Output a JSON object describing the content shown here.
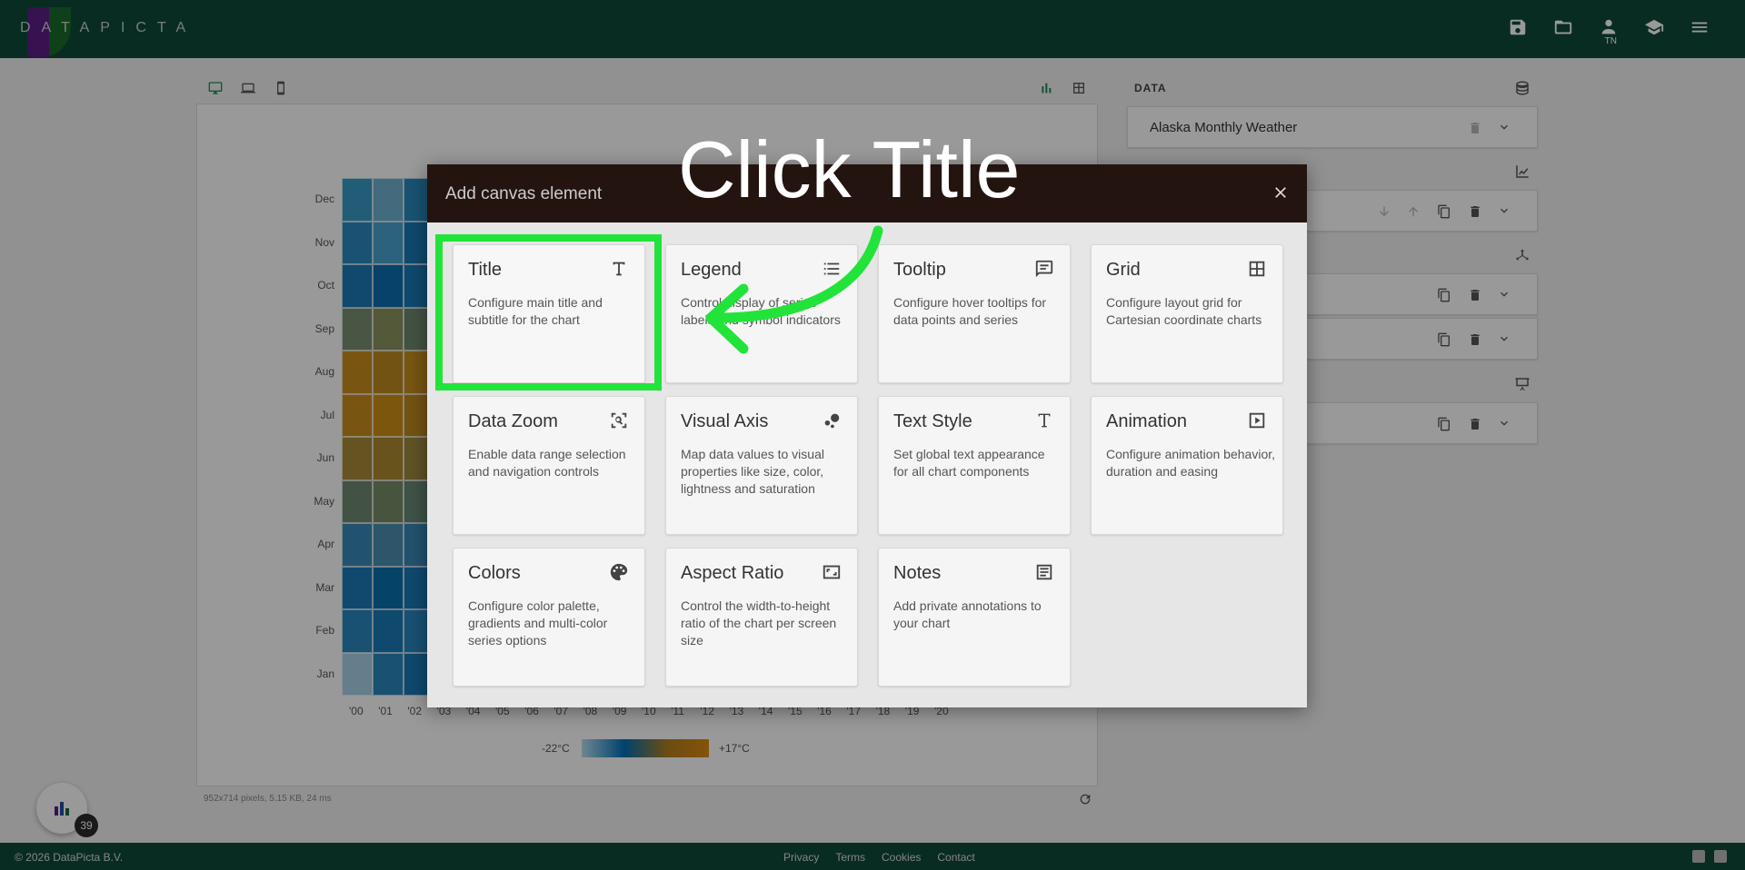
{
  "app": {
    "logo_text": "DATAPICTA",
    "user_initials": "TN",
    "logo_colors": [
      "#5a1f86",
      "#1c6b2a",
      "#1f4fa3"
    ]
  },
  "topbar_icons": [
    "save-icon",
    "folder-open-icon",
    "user-icon",
    "graduation-cap-icon",
    "menu-icon"
  ],
  "canvas": {
    "status": "952x714 pixels, 5.15 KB, 24 ms",
    "heatmap": {
      "months": [
        "Dec",
        "Nov",
        "Oct",
        "Sep",
        "Aug",
        "Jul",
        "Jun",
        "May",
        "Apr",
        "Mar",
        "Feb",
        "Jan"
      ],
      "years": [
        "'00",
        "'01",
        "'02",
        "'03",
        "'04",
        "'05",
        "'06",
        "'07",
        "'08",
        "'09",
        "'10",
        "'11",
        "'12",
        "'13",
        "'14",
        "'15",
        "'16",
        "'17",
        "'18",
        "'19",
        "'20"
      ],
      "legend_min": "-22°C",
      "legend_max": "+17°C",
      "visible_colors": [
        [
          "#3a9bc8",
          "#6fb3d0",
          "#2a8ac0"
        ],
        [
          "#2a8ac0",
          "#4aa4cd",
          "#1a7ab8"
        ],
        [
          "#1a7ab8",
          "#0a6fb0",
          "#1a7ab8"
        ],
        [
          "#7a9070",
          "#8a9460",
          "#708a70"
        ],
        [
          "#c8901e",
          "#c08a20",
          "#c8901e"
        ],
        [
          "#c8901e",
          "#d09018",
          "#c08a20"
        ],
        [
          "#a88a3a",
          "#b08a30",
          "#a08a40"
        ],
        [
          "#708a70",
          "#788e68",
          "#6a8a78"
        ],
        [
          "#3a8ab8",
          "#4a90b0",
          "#3a8ab8"
        ],
        [
          "#1a7ab8",
          "#0a70b0",
          "#1a7ab8"
        ],
        [
          "#2a88c0",
          "#1a7ab8",
          "#2a88c0"
        ],
        [
          "#a8d2e8",
          "#2a88c0",
          "#1a7ab8"
        ]
      ]
    }
  },
  "right_panel": {
    "title": "DATA",
    "dataset_label": "Alaska Monthly Weather"
  },
  "modal": {
    "title": "Add canvas element",
    "items": [
      {
        "name": "Title",
        "icon": "title-t-icon",
        "desc": "Configure main title and subtitle for the chart"
      },
      {
        "name": "Legend",
        "icon": "list-icon",
        "desc": "Control display of series labels and symbol indicators"
      },
      {
        "name": "Tooltip",
        "icon": "comment-icon",
        "desc": "Configure hover tooltips for data points and series"
      },
      {
        "name": "Grid",
        "icon": "grid-icon",
        "desc": "Configure layout grid for Cartesian coordinate charts"
      },
      {
        "name": "Data Zoom",
        "icon": "zoom-icon",
        "desc": "Enable data range selection and navigation controls"
      },
      {
        "name": "Visual Axis",
        "icon": "bubbles-icon",
        "desc": "Map data values to visual properties like size, color, lightness and saturation"
      },
      {
        "name": "Text Style",
        "icon": "text-style-icon",
        "desc": "Set global text appearance for all chart components"
      },
      {
        "name": "Animation",
        "icon": "play-icon",
        "desc": "Configure animation behavior, duration and easing"
      },
      {
        "name": "Colors",
        "icon": "palette-icon",
        "desc": "Configure color palette, gradients and multi-color series options"
      },
      {
        "name": "Aspect Ratio",
        "icon": "aspect-ratio-icon",
        "desc": "Control the width-to-height ratio of the chart per screen size"
      },
      {
        "name": "Notes",
        "icon": "notes-icon",
        "desc": "Add private annotations to your chart"
      }
    ]
  },
  "annotation": {
    "text": "Click Title",
    "color": "#22e33a"
  },
  "fab": {
    "badge": "39"
  },
  "footer": {
    "copyright": "© 2026 DataPicta B.V.",
    "links": [
      "Privacy",
      "Terms",
      "Cookies",
      "Contact"
    ]
  }
}
